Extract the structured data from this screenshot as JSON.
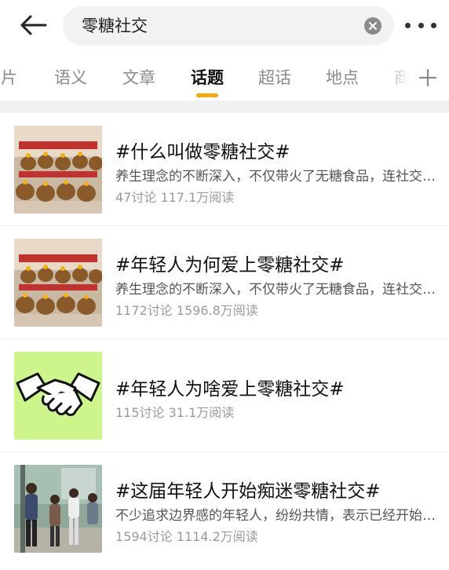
{
  "search": {
    "query": "零糖社交"
  },
  "tabs": [
    {
      "label": "图片"
    },
    {
      "label": "语义"
    },
    {
      "label": "文章"
    },
    {
      "label": "话题"
    },
    {
      "label": "超话"
    },
    {
      "label": "地点"
    },
    {
      "label": "商品"
    }
  ],
  "active_tab": "话题",
  "colors": {
    "accent": "#f7a800",
    "title": "#111111",
    "meta": "#9a9a9a"
  },
  "topics": [
    {
      "title": "#什么叫做零糖社交#",
      "desc": "养生理念的不断深入，不仅带火了无糖食品，连社交方式也开始“控糖”",
      "stats": "47讨论 117.1万阅读",
      "thumb": "capybara-plush-display"
    },
    {
      "title": "#年轻人为何爱上零糖社交#",
      "desc": "养生理念的不断深入，不仅带火了无糖食品，连社交方式也开始“控糖”",
      "stats": "1172讨论 1596.8万阅读",
      "thumb": "capybara-plush-display"
    },
    {
      "title": "#年轻人为啥爱上零糖社交#",
      "desc": "",
      "stats": "115讨论 31.1万阅读",
      "thumb": "handshake-icon"
    },
    {
      "title": "#这届年轻人开始痴迷零糖社交#",
      "desc": "不少追求边界感的年轻人，纷纷共情，表示已经开始零糖社交",
      "stats": "1594讨论 1114.2万阅读",
      "thumb": "people-greeting-photo"
    }
  ]
}
